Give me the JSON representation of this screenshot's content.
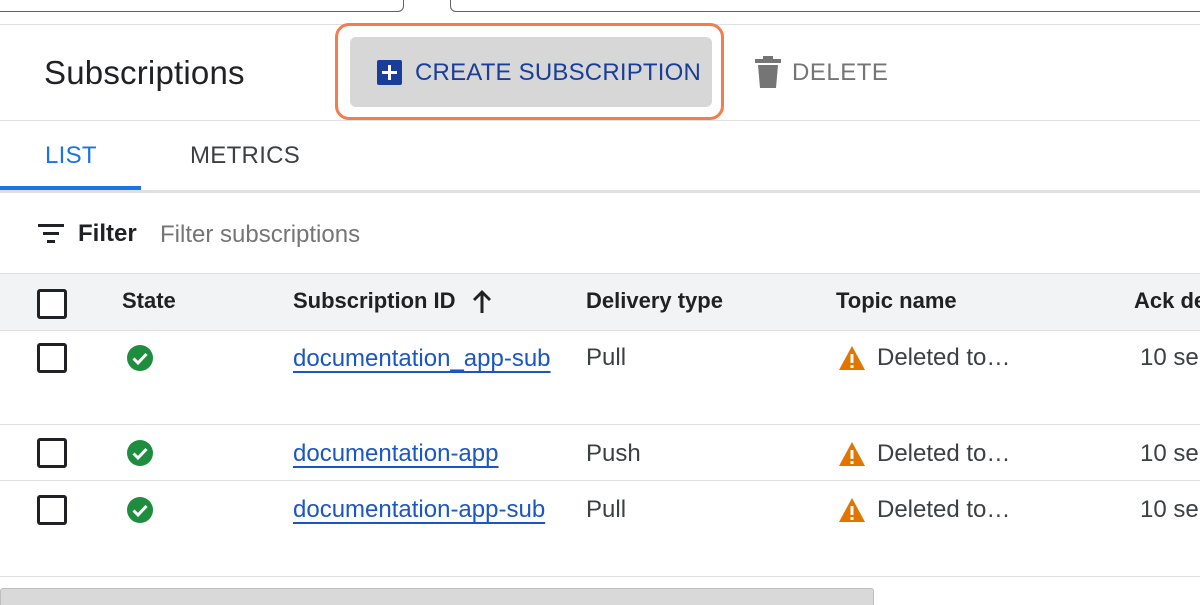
{
  "header": {
    "title": "Subscriptions",
    "create_label": "CREATE SUBSCRIPTION",
    "delete_label": "DELETE"
  },
  "tabs": [
    {
      "label": "LIST",
      "active": true
    },
    {
      "label": "METRICS",
      "active": false
    }
  ],
  "filter": {
    "label": "Filter",
    "placeholder": "Filter subscriptions"
  },
  "table": {
    "columns": [
      "State",
      "Subscription ID",
      "Delivery type",
      "Topic name",
      "Ack de"
    ],
    "sort": {
      "column": "Subscription ID",
      "direction": "ascending"
    },
    "rows": [
      {
        "state": "ok",
        "id": "documentation_app-sub",
        "delivery": "Pull",
        "topic": "Deleted to…",
        "ack": "10 se"
      },
      {
        "state": "ok",
        "id": "documentation-app",
        "delivery": "Push",
        "topic": "Deleted to…",
        "ack": "10 se"
      },
      {
        "state": "ok",
        "id": "documentation-app-sub",
        "delivery": "Pull",
        "topic": "Deleted to…",
        "ack": "10 se"
      }
    ]
  },
  "colors": {
    "accent": "#1a73e8",
    "create_text": "#1a3d99",
    "highlight": "#f47c4f",
    "success": "#1e8e3e",
    "warning": "#e37400",
    "link": "#1a56c4"
  },
  "icons": {
    "create": "plus-box-icon",
    "delete": "trash-icon",
    "filter": "filter-lines-icon",
    "sort": "arrow-up-icon",
    "state": "check-circle-icon",
    "topic_warning": "warning-triangle-icon"
  }
}
